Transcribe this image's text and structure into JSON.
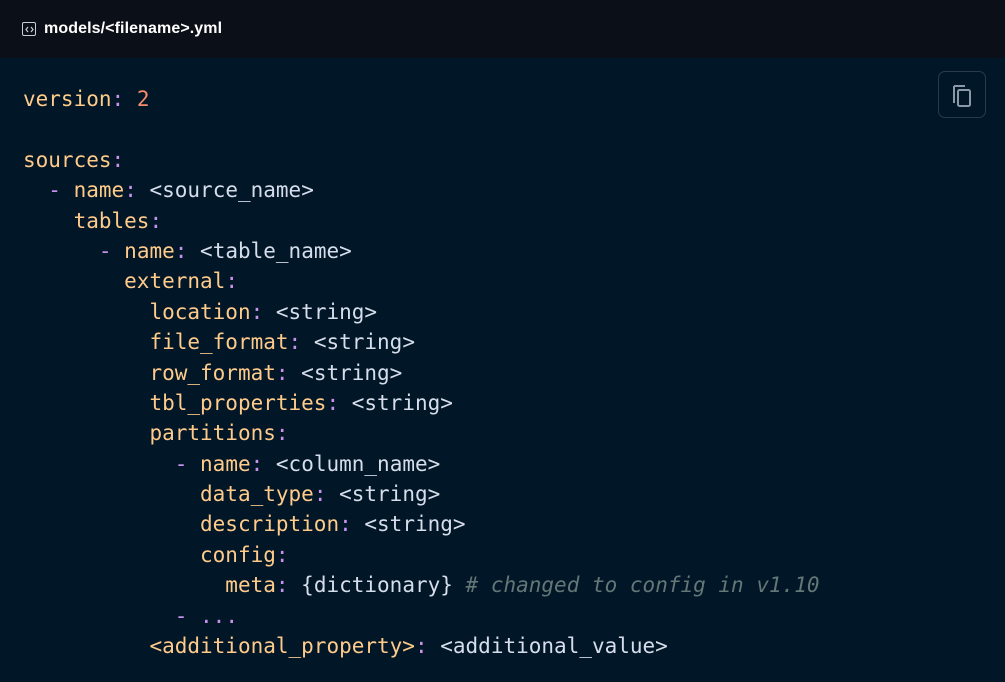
{
  "header": {
    "filename": "models/<filename>.yml",
    "icon": "code-file-icon"
  },
  "toolbar": {
    "copy_icon": "copy-icon"
  },
  "colors": {
    "background": "#011627",
    "header_background": "#0b0f17",
    "key": "#ffcb8b",
    "number": "#f78c6c",
    "punctuation": "#c792ea",
    "text": "#d6deeb",
    "comment": "#637777"
  },
  "code": {
    "l1": {
      "key": "version",
      "value": "2"
    },
    "l3": {
      "key": "sources"
    },
    "l4": {
      "dash": "-",
      "key": "name",
      "value": "<source_name>"
    },
    "l5": {
      "key": "tables"
    },
    "l6": {
      "dash": "-",
      "key": "name",
      "value": "<table_name>"
    },
    "l7": {
      "key": "external"
    },
    "l8": {
      "key": "location",
      "value": "<string>"
    },
    "l9": {
      "key": "file_format",
      "value": "<string>"
    },
    "l10": {
      "key": "row_format",
      "value": "<string>"
    },
    "l11": {
      "key": "tbl_properties",
      "value": "<string>"
    },
    "l12": {
      "key": "partitions"
    },
    "l13": {
      "dash": "-",
      "key": "name",
      "value": "<column_name>"
    },
    "l14": {
      "key": "data_type",
      "value": "<string>"
    },
    "l15": {
      "key": "description",
      "value": "<string>"
    },
    "l16": {
      "key": "config"
    },
    "l17": {
      "key": "meta",
      "value": "{dictionary}",
      "comment": "# changed to config in v1.10"
    },
    "l18": {
      "dash": "-",
      "ellipsis": "..."
    },
    "l19": {
      "key": "<additional_property>",
      "value": "<additional_value>"
    }
  }
}
